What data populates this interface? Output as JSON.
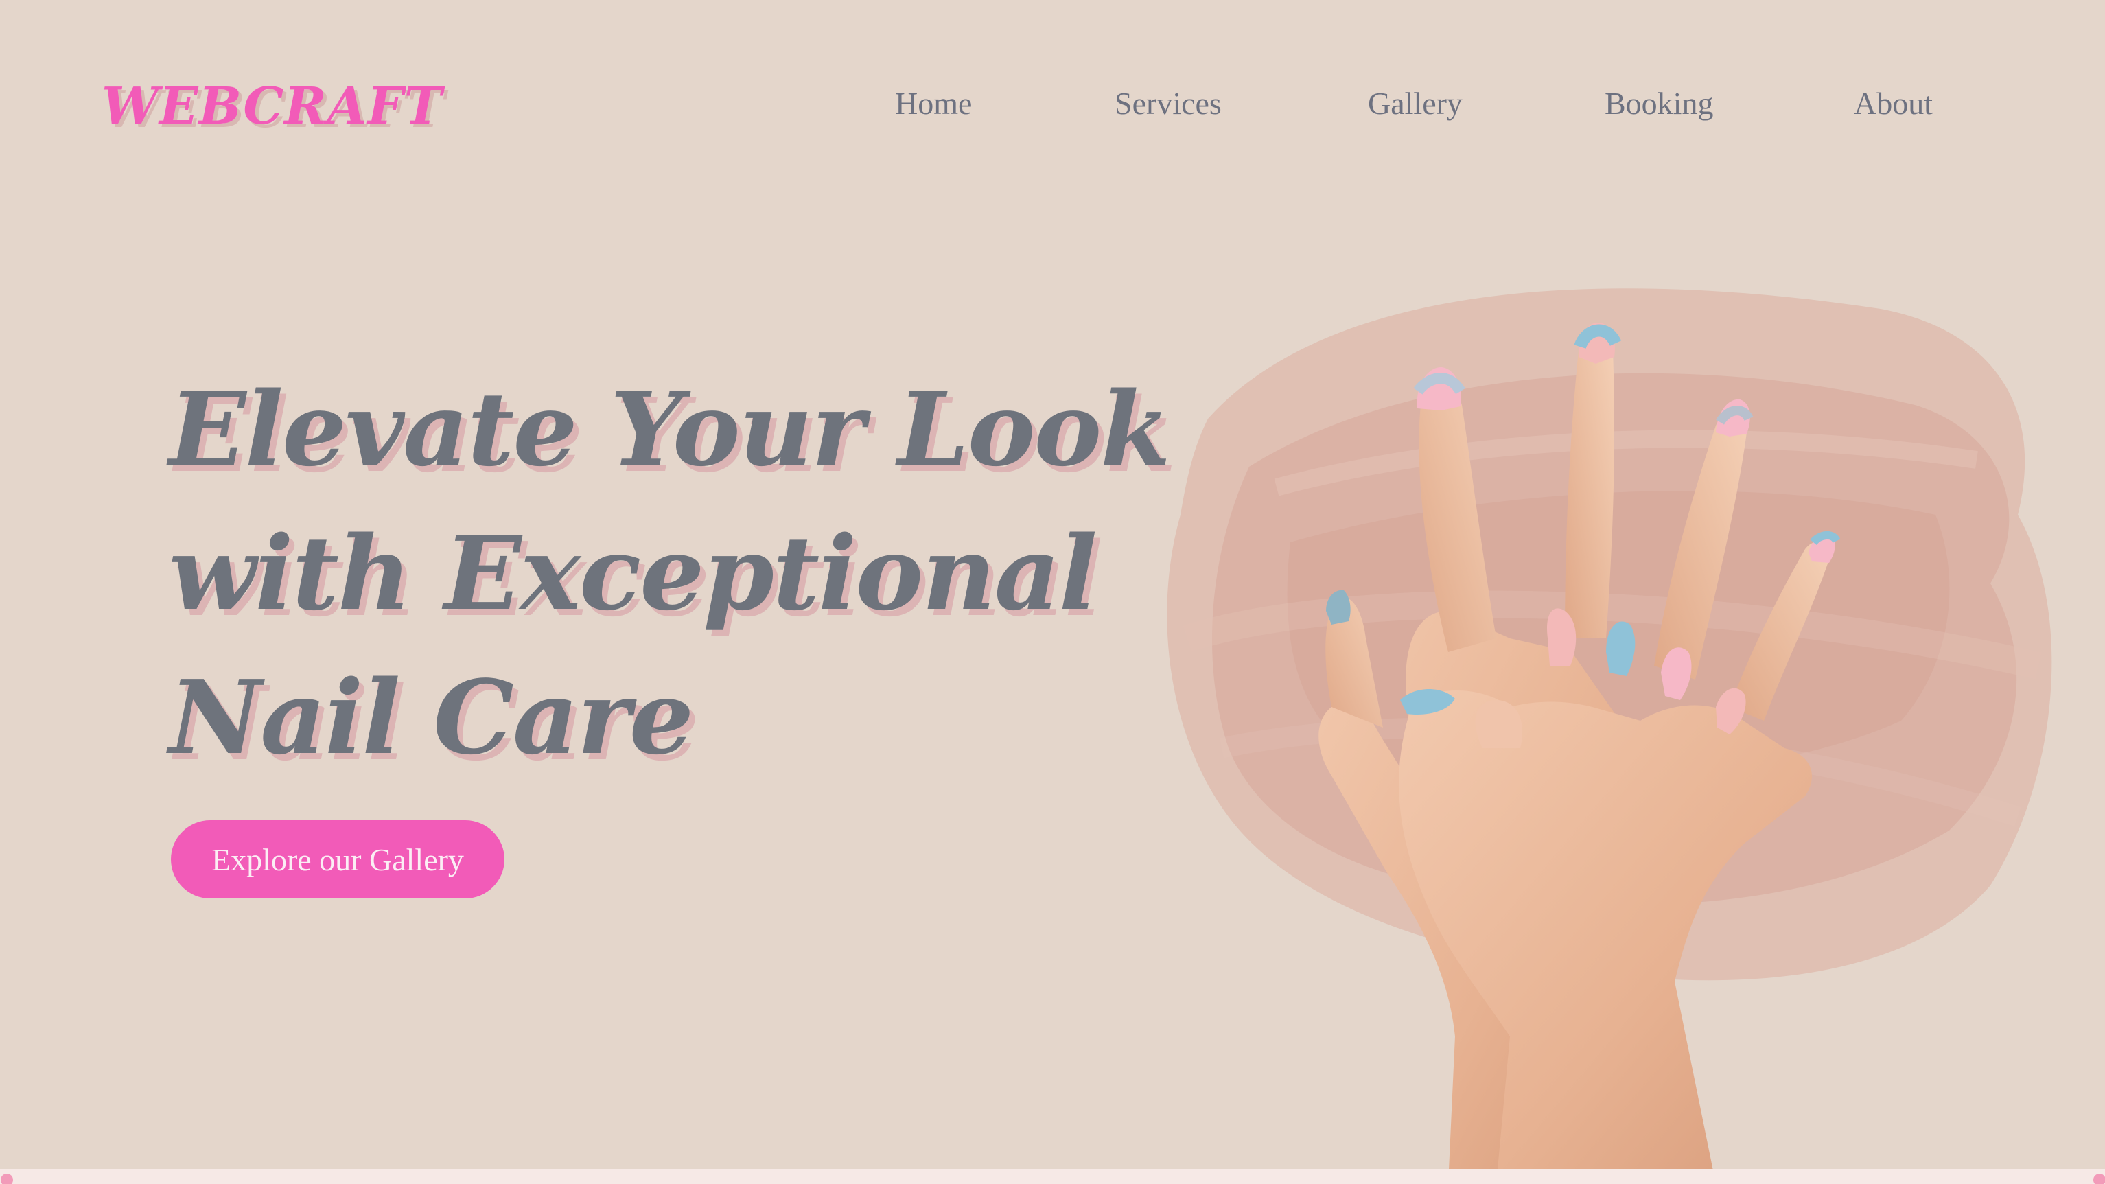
{
  "brand": {
    "logo_text": "WEBCRAFT"
  },
  "nav": {
    "items": [
      {
        "label": "Home"
      },
      {
        "label": "Services"
      },
      {
        "label": "Gallery"
      },
      {
        "label": "Booking"
      },
      {
        "label": "About"
      }
    ]
  },
  "hero": {
    "title_lines": [
      "Elevate Your Look",
      "with Exceptional",
      "Nail Care"
    ],
    "cta_label": "Explore our Gallery",
    "image_subject": "hands-with-pastel-nails"
  },
  "colors": {
    "background": "#e4d6cb",
    "accent_pink": "#f25bb8",
    "text_gray": "#6e737c",
    "title_shadow": "#dcb4b4",
    "brush_stroke": "#d9a99a"
  }
}
